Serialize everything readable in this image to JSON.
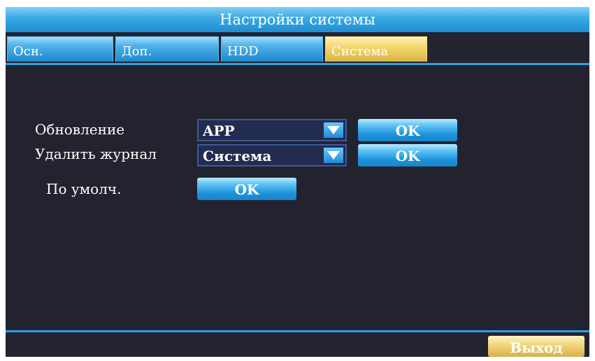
{
  "window": {
    "title": "Настройки системы"
  },
  "tabs": [
    {
      "label": "Осн.",
      "active": false
    },
    {
      "label": "Доп.",
      "active": false
    },
    {
      "label": "HDD",
      "active": false
    },
    {
      "label": "Система",
      "active": true
    }
  ],
  "settings": {
    "update": {
      "label": "Обновление",
      "value": "APP",
      "button": "OK"
    },
    "delete_log": {
      "label": "Удалить журнал",
      "value": "Система",
      "button": "OK"
    },
    "defaults": {
      "label": "По умолч.",
      "button": "OK"
    }
  },
  "footer": {
    "exit_label": "Выход"
  },
  "colors": {
    "accent": "#2aa0e6",
    "active_tab": "#f4d86f",
    "background": "#22232e"
  }
}
